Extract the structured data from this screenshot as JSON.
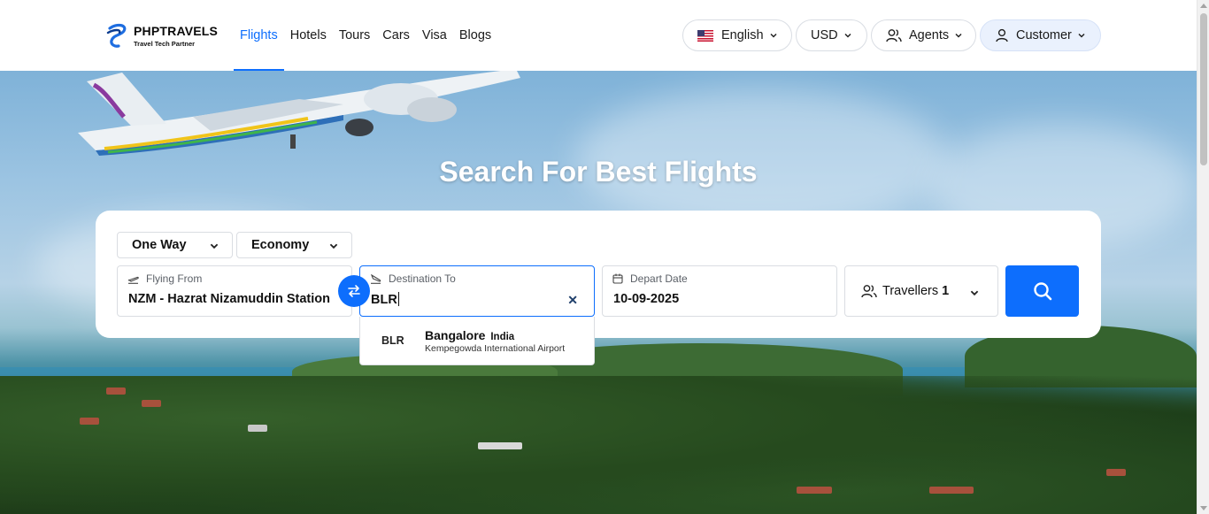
{
  "brand": {
    "name": "PHPTRAVELS",
    "tagline": "Travel Tech Partner"
  },
  "nav": {
    "items": [
      {
        "label": "Flights",
        "active": true
      },
      {
        "label": "Hotels",
        "active": false
      },
      {
        "label": "Tours",
        "active": false
      },
      {
        "label": "Cars",
        "active": false
      },
      {
        "label": "Visa",
        "active": false
      },
      {
        "label": "Blogs",
        "active": false
      }
    ]
  },
  "header": {
    "language": "English",
    "currency": "USD",
    "agents": "Agents",
    "customer": "Customer"
  },
  "hero": {
    "title": "Search For Best Flights"
  },
  "search": {
    "trip_type": "One Way",
    "cabin_class": "Economy",
    "from": {
      "label": "Flying From",
      "value": "NZM - Hazrat Nizamuddin Station"
    },
    "to": {
      "label": "Destination To",
      "value": "BLR"
    },
    "date": {
      "label": "Depart Date",
      "value": "10-09-2025"
    },
    "travellers": {
      "label": "Travellers",
      "count": "1"
    }
  },
  "suggestions": [
    {
      "code": "BLR",
      "city": "Bangalore",
      "country": "India",
      "airport": "Kempegowda International Airport"
    }
  ],
  "colors": {
    "accent": "#0d6efd",
    "customer_bg": "#eaf1fd"
  },
  "icons": [
    "flag-us-icon",
    "chevron-down-icon",
    "users-icon",
    "user-icon",
    "plane-takeoff-icon",
    "plane-landing-icon",
    "swap-icon",
    "calendar-icon",
    "close-icon",
    "search-icon"
  ]
}
